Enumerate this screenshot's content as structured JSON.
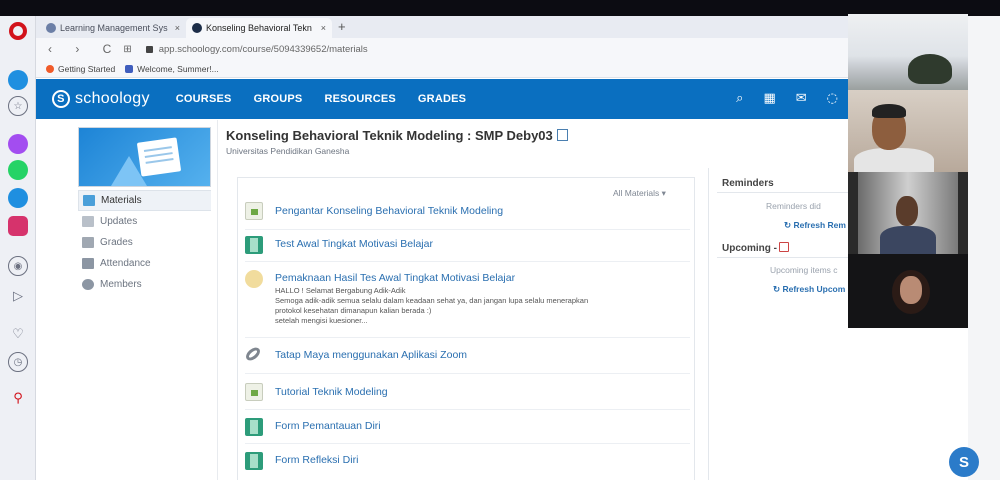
{
  "browser": {
    "tabs": [
      {
        "label": "Learning Management Sys",
        "close": "×"
      },
      {
        "label": "Konseling Behavioral Tekn",
        "close": "×"
      }
    ],
    "new_tab": "+",
    "nav_symbols": "‹ › C",
    "url": "app.schoology.com/course/5094339652/materials",
    "bookmarks": [
      "Getting Started",
      "Welcome, Summer!..."
    ]
  },
  "header": {
    "logo": "schoology",
    "logo_mark": "S",
    "nav": [
      "COURSES",
      "GROUPS",
      "RESOURCES",
      "GRADES"
    ],
    "tools": [
      "search-icon",
      "calendar-icon",
      "mail-icon",
      "notification-icon"
    ]
  },
  "course": {
    "title": "Konseling Behavioral Teknik Modeling : SMP Deby03",
    "subtitle": "Universitas Pendidikan Ganesha"
  },
  "menu": [
    {
      "label": "Materials",
      "active": true
    },
    {
      "label": "Updates",
      "active": false
    },
    {
      "label": "Grades",
      "active": false
    },
    {
      "label": "Attendance",
      "active": false
    },
    {
      "label": "Members",
      "active": false
    }
  ],
  "materials": {
    "filter_label": "All Materials ▾",
    "items": [
      {
        "type": "document",
        "title": "Pengantar Konseling Behavioral Teknik Modeling"
      },
      {
        "type": "assignment",
        "title": "Test Awal Tingkat Motivasi Belajar"
      },
      {
        "type": "discussion",
        "title": "Pemaknaan Hasil Tes Awal Tingkat Motivasi Belajar",
        "description": [
          "HALLO ! Selamat Bergabung Adik-Adik",
          "Semoga adik-adik semua selalu dalam keadaan sehat ya, dan jangan lupa selalu menerapkan",
          "protokol kesehatan dimanapun kalian berada :)",
          "setelah mengisi kuesioner..."
        ]
      },
      {
        "type": "link",
        "title": "Tatap Maya menggunakan Aplikasi Zoom"
      },
      {
        "type": "document",
        "title": "Tutorial Teknik Modeling"
      },
      {
        "type": "assignment",
        "title": "Form Pemantauan Diri"
      },
      {
        "type": "assignment",
        "title": "Form Refleksi Diri"
      }
    ]
  },
  "sidebar_right": {
    "reminders_title": "Reminders",
    "reminders_empty": "Reminders did",
    "reminders_refresh": "Refresh Rem",
    "upcoming_title": "Upcoming -",
    "upcoming_empty": "Upcoming items c",
    "upcoming_refresh": "Refresh Upcom"
  },
  "chat_button": "S",
  "more_symbol": "...",
  "colors": {
    "brand": "#0a6fc0",
    "link": "#2a6fb0",
    "opera_red": "#d2121b"
  }
}
